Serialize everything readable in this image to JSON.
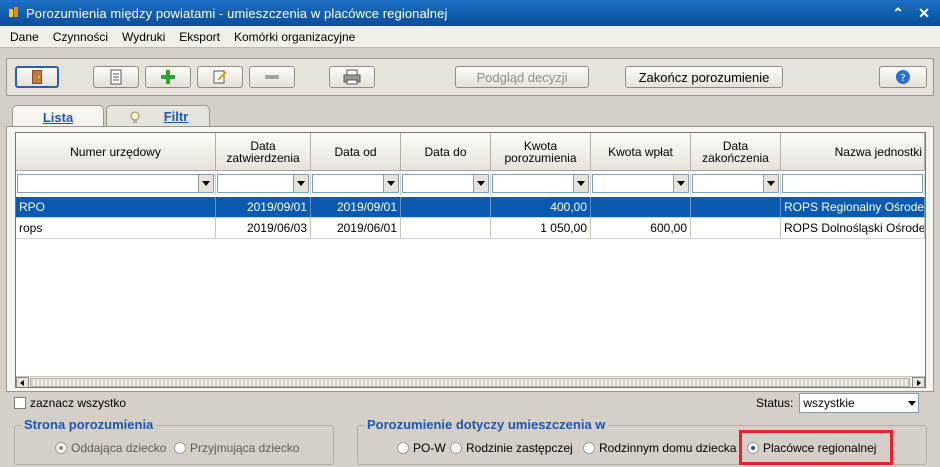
{
  "window": {
    "title": "Porozumienia między powiatami - umieszczenia w placówce regionalnej"
  },
  "menu": [
    "Dane",
    "Czynności",
    "Wydruki",
    "Eksport",
    "Komórki organizacyjne"
  ],
  "toolbar": {
    "preview_label": "Podgląd decyzji",
    "finish_label": "Zakończ porozumienie"
  },
  "tabs": [
    "Lista",
    "Filtr"
  ],
  "table": {
    "columns": [
      "Numer urzędowy",
      "Data\nzatwierdzenia",
      "Data od",
      "Data do",
      "Kwota\nporozumienia",
      "Kwota wpłat",
      "Data\nzakończenia",
      "Nazwa jednostki"
    ],
    "rows": [
      [
        "RPO",
        "2019/09/01",
        "2019/09/01",
        "",
        "400,00",
        "",
        "",
        "ROPS Regionalny Ośrodek"
      ],
      [
        "rops",
        "2019/06/03",
        "2019/06/01",
        "",
        "1 050,00",
        "600,00",
        "",
        "ROPS Dolnośląski Ośrodek"
      ]
    ]
  },
  "select_all_label": "zaznacz wszystko",
  "status": {
    "label": "Status:",
    "value": "wszystkie"
  },
  "strona": {
    "legend": "Strona porozumienia",
    "options": [
      "Oddająca dziecko",
      "Przyjmująca dziecko"
    ]
  },
  "dotyczy": {
    "legend": "Porozumienie dotyczy umieszczenia w",
    "options": [
      "PO-W",
      "Rodzinie zastępczej",
      "Rodzinnym domu dziecka",
      "Placówce regionalnej"
    ]
  },
  "colors": {
    "selection": "#0b5ab1",
    "accent": "#1c56b5",
    "highlight": "#e8212a"
  }
}
